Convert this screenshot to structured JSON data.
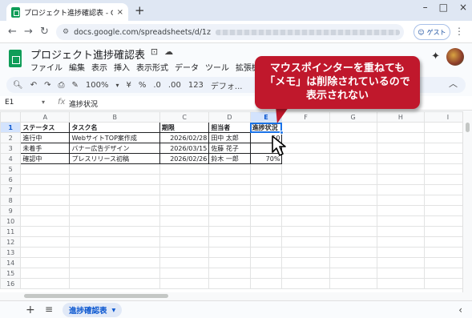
{
  "browser": {
    "tab_title": "プロジェクト進捗確認表 - Google",
    "tab_close": "×",
    "new_tab": "+",
    "url": "docs.google.com/spreadsheets/d/1z",
    "guest_label": "ゲスト",
    "window_controls": [
      "–",
      "□",
      "×"
    ]
  },
  "doc": {
    "title": "プロジェクト進捗確認表",
    "menus": [
      "ファイル",
      "編集",
      "表示",
      "挿入",
      "表示形式",
      "データ",
      "ツール",
      "拡張機能"
    ]
  },
  "toolbar": {
    "zoom": "100%",
    "currency": "¥",
    "percent": "%",
    "decimal_dec": ".0",
    "decimal_inc": ".00",
    "number_format": "123",
    "font": "デフォ..."
  },
  "formula_bar": {
    "cell_ref": "E1",
    "fx": "fx",
    "content": "進捗状況"
  },
  "columns": [
    "A",
    "B",
    "C",
    "D",
    "E",
    "F",
    "G",
    "H",
    "I"
  ],
  "rows": [
    [
      "ステータス",
      "タスク名",
      "期限",
      "担当者",
      "進捗状況"
    ],
    [
      "進行中",
      "WebサイトTOP案作成",
      "2026/02/28",
      "田中 太郎",
      "50"
    ],
    [
      "未着手",
      "バナー広告デザイン",
      "2026/03/15",
      "佐藤 花子",
      "0"
    ],
    [
      "確認中",
      "プレスリリース初稿",
      "2026/02/26",
      "鈴木 一郎",
      "70%"
    ]
  ],
  "row_count": 16,
  "callout": {
    "line1": "マウスポインターを重ねても",
    "line2": "「メモ」は削除されているので",
    "line3": "表示されない"
  },
  "sheet_bar": {
    "add": "+",
    "all_sheets": "≡",
    "active_sheet": "進捗確認表",
    "dropdown": "▾"
  },
  "colors": {
    "callout": "#c0182c",
    "selection": "#1a73e8",
    "sheets_green": "#0f9d58"
  }
}
